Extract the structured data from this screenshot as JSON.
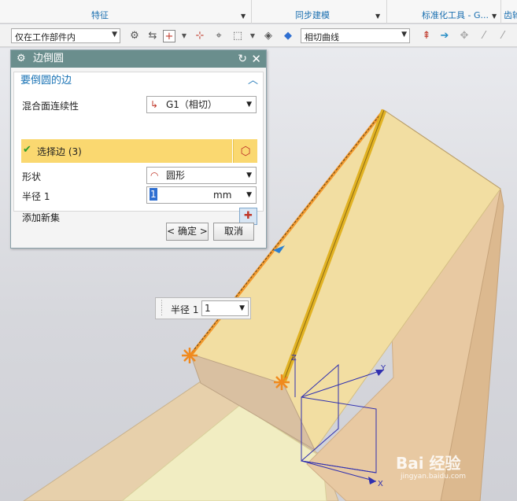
{
  "ribbon": {
    "groups": [
      {
        "label": "特征"
      },
      {
        "label": "同步建模"
      },
      {
        "label": "标准化工具 - G..."
      },
      {
        "label": "齿轮"
      }
    ]
  },
  "toolbar": {
    "filter_value": "仅在工作部件内",
    "curve_rule_value": "相切曲线"
  },
  "dialog": {
    "title": "边倒圆",
    "section_title": "要倒圆的边",
    "continuity_label": "混合面连续性",
    "continuity_value": "G1（相切）",
    "select_edge_label": "选择边 (3)",
    "shape_label": "形状",
    "shape_value": "圆形",
    "radius_label": "半径 1",
    "radius_value": "1",
    "radius_unit": "mm",
    "add_set_label": "添加新集",
    "ok_label": "< 确定 >",
    "cancel_label": "取消"
  },
  "float_input": {
    "label": "半径 1",
    "value": "1"
  },
  "viewport": {
    "axis_x": "X",
    "axis_y": "Y",
    "axis_z": "Z"
  },
  "watermark": {
    "text": "Bai 经验",
    "sub": "jingyan.baidu.com"
  },
  "colors": {
    "dialog_title_bg": "#6a8e8d",
    "selected_row_bg": "#fad870",
    "part_face": "#f2dea2",
    "highlight_edge": "#f39a2e"
  }
}
